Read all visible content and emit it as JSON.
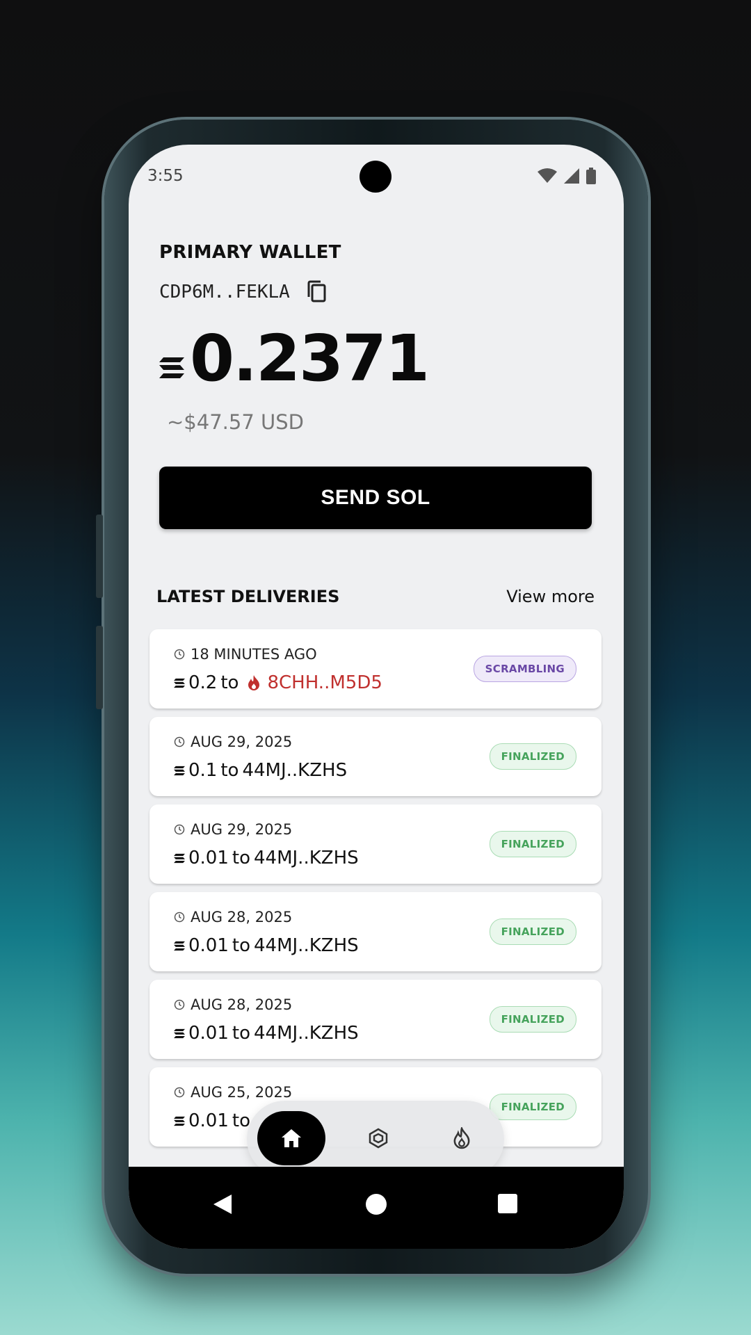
{
  "status_bar": {
    "time": "3:55"
  },
  "wallet": {
    "title": "PRIMARY WALLET",
    "address": "CDP6M..FEKLA",
    "balance": "0.2371",
    "usd_value": "~$47.57 USD"
  },
  "send_button_label": "SEND SOL",
  "deliveries": {
    "title": "LATEST DELIVERIES",
    "view_more": "View more",
    "items": [
      {
        "time": "18 MINUTES AGO",
        "amount": "0.2",
        "to": "to",
        "destination": "8CHH..M5D5",
        "status": "SCRAMBLING"
      },
      {
        "time": "AUG 29, 2025",
        "amount": "0.1",
        "to": "to",
        "destination": "44MJ..KZHS",
        "status": "FINALIZED"
      },
      {
        "time": "AUG 29, 2025",
        "amount": "0.01",
        "to": "to",
        "destination": "44MJ..KZHS",
        "status": "FINALIZED"
      },
      {
        "time": "AUG 28, 2025",
        "amount": "0.01",
        "to": "to",
        "destination": "44MJ..KZHS",
        "status": "FINALIZED"
      },
      {
        "time": "AUG 28, 2025",
        "amount": "0.01",
        "to": "to",
        "destination": "44MJ..KZHS",
        "status": "FINALIZED"
      },
      {
        "time": "AUG 25, 2025",
        "amount": "0.01",
        "to": "to",
        "destination": "",
        "status": "FINALIZED"
      }
    ]
  },
  "bottom_nav": {
    "items": [
      "home-icon",
      "cube-icon",
      "flame-icon"
    ],
    "active": "home-icon"
  },
  "colors": {
    "accent": "#000000",
    "burn_red": "#c0302e",
    "finalized_green": "#46a35c",
    "scrambling_purple": "#6a48a6"
  }
}
